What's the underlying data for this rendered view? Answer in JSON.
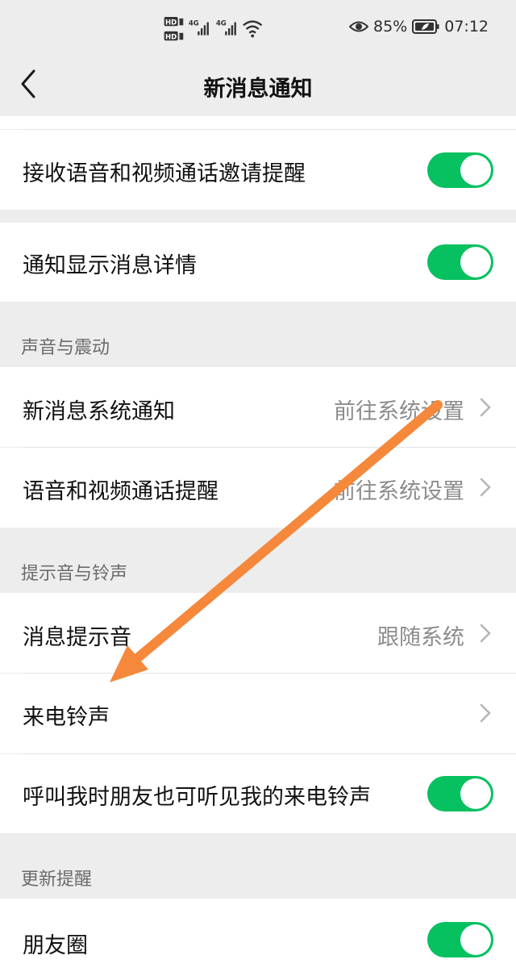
{
  "status_bar": {
    "hd1": "HD",
    "hd2": "HD",
    "net1": "4G",
    "net2": "4G",
    "battery": "85%",
    "time": "07:12"
  },
  "nav": {
    "title": "新消息通知"
  },
  "rows": {
    "voice_video_invite": {
      "label": "接收语音和视频通话邀请提醒",
      "on": true
    },
    "show_details": {
      "label": "通知显示消息详情",
      "on": true
    },
    "system_notify": {
      "label": "新消息系统通知",
      "value": "前往系统设置"
    },
    "call_remind": {
      "label": "语音和视频通话提醒",
      "value": "前往系统设置"
    },
    "msg_tone": {
      "label": "消息提示音",
      "value": "跟随系统"
    },
    "ringtone": {
      "label": "来电铃声"
    },
    "friends_hear": {
      "label": "呼叫我时朋友也可听见我的来电铃声",
      "on": true
    },
    "moments": {
      "label": "朋友圈",
      "on": true
    }
  },
  "sections": {
    "sound": "声音与震动",
    "tone": "提示音与铃声",
    "update": "更新提醒"
  },
  "colors": {
    "accent": "#07c160",
    "annotation_arrow": "#f5883b"
  },
  "icons": {
    "back": "chevron-left-icon",
    "chevron": "chevron-right-icon",
    "eye": "eye-icon",
    "battery": "battery-icon",
    "wifi": "wifi-icon",
    "signal": "signal-icon"
  }
}
